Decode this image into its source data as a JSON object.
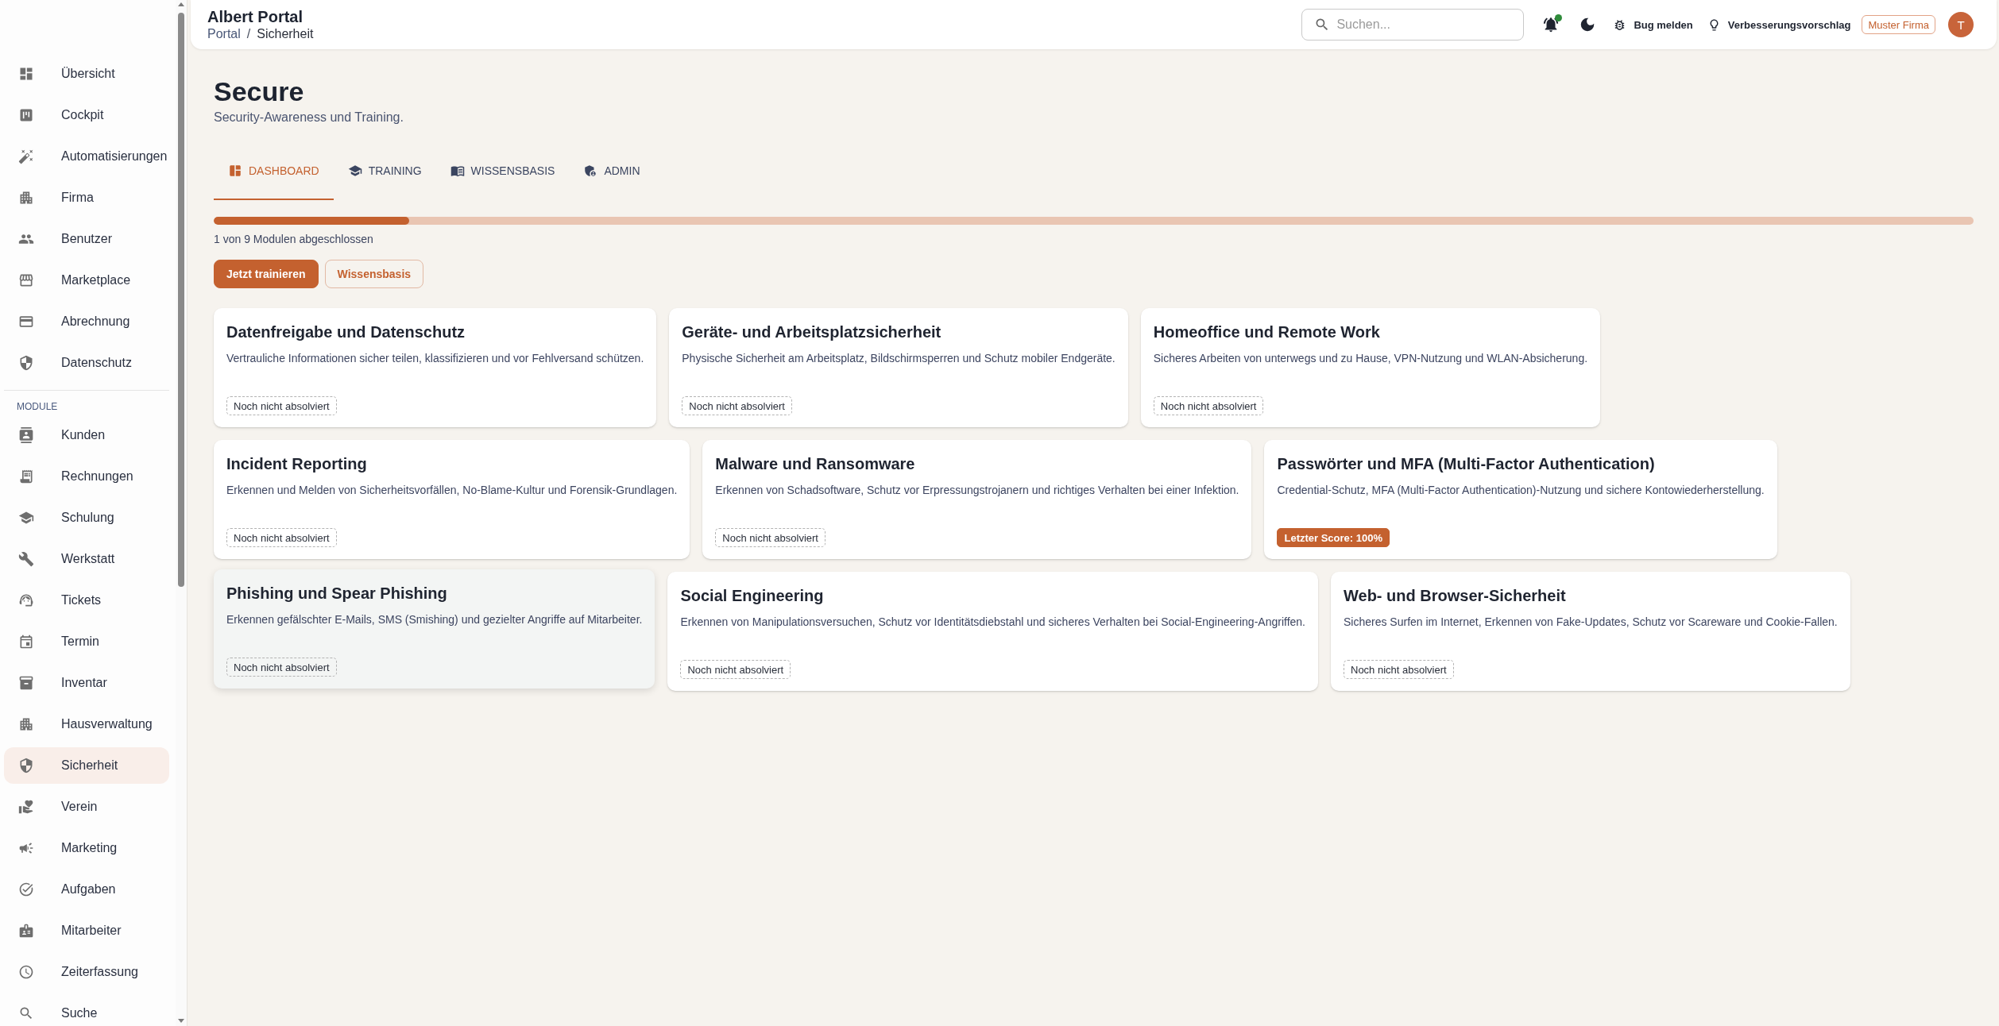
{
  "sidebar": {
    "groups": [
      {
        "items": [
          {
            "label": "Übersicht",
            "selected": false
          },
          {
            "label": "Cockpit",
            "selected": false
          },
          {
            "label": "Automatisierungen",
            "selected": false
          },
          {
            "label": "Firma",
            "selected": false
          },
          {
            "label": "Benutzer",
            "selected": false
          },
          {
            "label": "Marketplace",
            "selected": false
          },
          {
            "label": "Abrechnung",
            "selected": false
          },
          {
            "label": "Datenschutz",
            "selected": false
          }
        ]
      },
      {
        "heading": "MODULE",
        "items": [
          {
            "label": "Kunden",
            "selected": false
          },
          {
            "label": "Rechnungen",
            "selected": false
          },
          {
            "label": "Schulung",
            "selected": false
          },
          {
            "label": "Werkstatt",
            "selected": false
          },
          {
            "label": "Tickets",
            "selected": false
          },
          {
            "label": "Termin",
            "selected": false
          },
          {
            "label": "Inventar",
            "selected": false
          },
          {
            "label": "Hausverwaltung",
            "selected": false
          },
          {
            "label": "Sicherheit",
            "selected": true
          },
          {
            "label": "Verein",
            "selected": false
          },
          {
            "label": "Marketing",
            "selected": false
          },
          {
            "label": "Aufgaben",
            "selected": false
          },
          {
            "label": "Mitarbeiter",
            "selected": false
          },
          {
            "label": "Zeiterfassung",
            "selected": false
          },
          {
            "label": "Suche",
            "selected": false
          }
        ]
      }
    ]
  },
  "header": {
    "title": "Albert Portal",
    "breadcrumb": [
      {
        "label": "Portal",
        "kind": "link"
      },
      {
        "label": "/",
        "kind": "separator"
      },
      {
        "label": "Sicherheit",
        "kind": "current"
      }
    ],
    "search": {
      "placeholder": "Suchen..."
    },
    "notifications": {
      "unread": true
    },
    "actions": [
      {
        "label": "Bug melden"
      },
      {
        "label": "Verbesserungsvorschlag"
      }
    ],
    "company": "Muster Firma",
    "avatar": "T"
  },
  "page": {
    "title": "Secure",
    "subtitle": "Security-Awareness und Training.",
    "tabs": [
      {
        "label": "DASHBOARD",
        "selected": true
      },
      {
        "label": "TRAINING",
        "selected": false
      },
      {
        "label": "WISSENSBASIS",
        "selected": false
      },
      {
        "label": "ADMIN",
        "selected": false
      }
    ],
    "progress": {
      "level": 0.111,
      "caption": "1 von 9 Modulen abgeschlossen"
    },
    "buttons": [
      {
        "label": "Jetzt trainieren",
        "kind": "primary"
      },
      {
        "label": "Wissensbasis",
        "kind": "outline"
      }
    ],
    "modules": [
      {
        "title": "Datenfreigabe und Datenschutz",
        "description": "Vertrauliche Informationen sicher teilen, klassifizieren und vor Fehlversand schützen.",
        "hovered": false,
        "status": {
          "kind": "open",
          "label": "Noch nicht absolviert"
        }
      },
      {
        "title": "Geräte- und Arbeitsplatzsicherheit",
        "description": "Physische Sicherheit am Arbeitsplatz, Bildschirmsperren und Schutz mobiler Endgeräte.",
        "hovered": false,
        "status": {
          "kind": "open",
          "label": "Noch nicht absolviert"
        }
      },
      {
        "title": "Homeoffice und Remote Work",
        "description": "Sicheres Arbeiten von unterwegs und zu Hause, VPN-Nutzung und WLAN-Absicherung.",
        "hovered": false,
        "status": {
          "kind": "open",
          "label": "Noch nicht absolviert"
        }
      },
      {
        "title": "Incident Reporting",
        "description": "Erkennen und Melden von Sicherheitsvorfällen, No-Blame-Kultur und Forensik-Grundlagen.",
        "hovered": false,
        "status": {
          "kind": "open",
          "label": "Noch nicht absolviert"
        }
      },
      {
        "title": "Malware und Ransomware",
        "description": "Erkennen von Schadsoftware, Schutz vor Erpressungstrojanern und richtiges Verhalten bei einer Infektion.",
        "hovered": false,
        "status": {
          "kind": "open",
          "label": "Noch nicht absolviert"
        }
      },
      {
        "title": "Passwörter und MFA (Multi-Factor Authentication)",
        "description": "Credential-Schutz, MFA (Multi-Factor Authentication)-Nutzung und sichere Kontowiederherstellung.",
        "hovered": false,
        "status": {
          "kind": "score",
          "label": "Letzter Score: 100%"
        }
      },
      {
        "title": "Phishing und Spear Phishing",
        "description": "Erkennen gefälschter E-Mails, SMS (Smishing) und gezielter Angriffe auf Mitarbeiter.",
        "hovered": true,
        "status": {
          "kind": "open",
          "label": "Noch nicht absolviert"
        }
      },
      {
        "title": "Social Engineering",
        "description": "Erkennen von Manipulationsversuchen, Schutz vor Identitätsdiebstahl und sicheres Verhalten bei Social-Engineering-Angriffen.",
        "hovered": false,
        "status": {
          "kind": "open",
          "label": "Noch nicht absolviert"
        }
      },
      {
        "title": "Web- und Browser-Sicherheit",
        "description": "Sicheres Surfen im Internet, Erkennen von Fake-Updates, Schutz vor Scareware und Cookie-Fallen.",
        "hovered": false,
        "status": {
          "kind": "open",
          "label": "Noch nicht absolviert"
        }
      }
    ]
  }
}
